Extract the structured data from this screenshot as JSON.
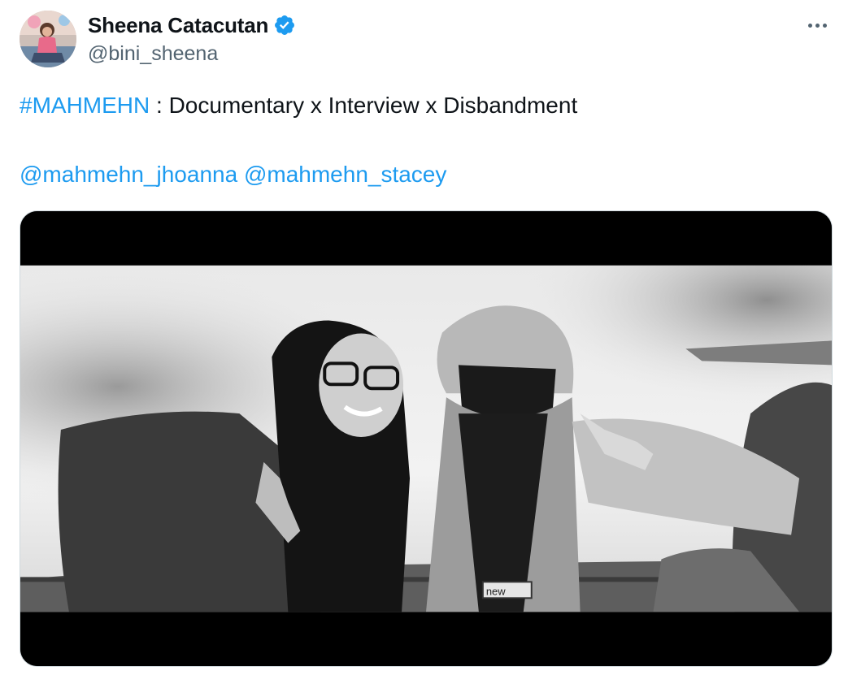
{
  "author": {
    "display_name": "Sheena Catacutan",
    "handle": "@bini_sheena",
    "verified": true,
    "avatar_icon": "profile-photo"
  },
  "menu": {
    "more_icon": "more-horizontal-icon"
  },
  "tweet": {
    "hashtag": "#MAHMEHN",
    "text_after_hashtag": " : Documentary x Interview x Disbandment",
    "mentions": [
      "@mahmehn_jhoanna",
      "@mahmehn_stacey"
    ]
  },
  "media": {
    "type": "video-still",
    "style": "black-and-white letterboxed",
    "visible_text": "new"
  },
  "colors": {
    "link": "#1d9bf0",
    "verified_badge": "#1d9bf0",
    "text": "#0f1419",
    "secondary": "#536471"
  }
}
